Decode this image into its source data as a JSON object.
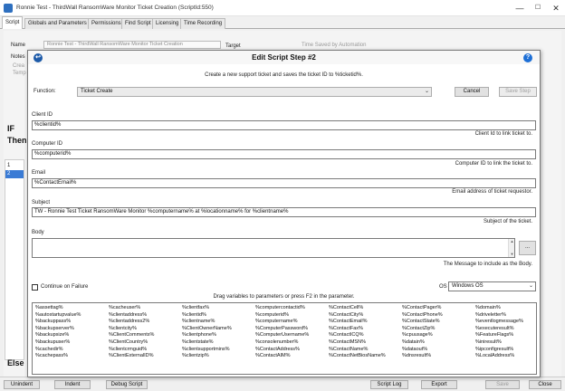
{
  "window": {
    "title": "Ronnie Test - ThirdWall RansomWare Monitor Ticket Creation   (ScriptId:550)",
    "min": "—",
    "max": "☐",
    "close": "✕"
  },
  "tabs": [
    "Script",
    "Globals and Parameters",
    "Permissions",
    "Find Script",
    "Licensing",
    "Time Recording"
  ],
  "background": {
    "name_label": "Name",
    "name_value": "Ronnie Test - ThirdWall RansomWare Monitor Ticket Creation",
    "target_label": "Target",
    "time_saved_label": "Time Saved by Automation",
    "notes_label": "Notes",
    "notes_line1": "Crea",
    "notes_line2": "Temp",
    "if_label": "IF",
    "then_label": "Then",
    "else_label": "Else",
    "rows": [
      "1",
      "2"
    ]
  },
  "bottom_buttons": [
    "Unindent",
    "Indent",
    "Debug Script",
    "Script Log",
    "Export",
    "Save",
    "Close"
  ],
  "dialog": {
    "title": "Edit Script Step #2",
    "left_icon": "↩",
    "right_icon": "?",
    "description": "Create a new support ticket and saves the ticket ID to %ticketid%.",
    "function_label": "Function:",
    "function_value": "Ticket Create",
    "cancel_label": "Cancel",
    "save_step_label": "Save Step",
    "fields": [
      {
        "label": "Client ID",
        "value": "%clientid%",
        "hint": "Client Id to link ticket to."
      },
      {
        "label": "Computer ID",
        "value": "%computerid%",
        "hint": "Computer ID to link the ticket to."
      },
      {
        "label": "Email",
        "value": "%ContactEmail%",
        "hint": "Email address of ticket requestor."
      },
      {
        "label": "Subject",
        "value": "TW - Ronnie Test Ticket RansomWare Monitor %computername% at %locationname% for %clientname%",
        "hint": "Subject of the ticket."
      }
    ],
    "body_label": "Body",
    "body_hint": "The Message to include as the Body.",
    "ellipsis_label": "...",
    "continue_label": "Continue on Failure",
    "continue_checked": false,
    "os_label": "OS",
    "os_value": "Windows OS",
    "drag_hint": "Drag variables to parameters or press F2 in the parameter.",
    "variables": [
      [
        "%assettag%",
        "%autostartupvalue%",
        "%backuppass%",
        "%backupserver%",
        "%backupsize%",
        "%backupuser%",
        "%cachedir%",
        "%cachepass%"
      ],
      [
        "%cacheuser%",
        "%clientaddress%",
        "%clientaddress2%",
        "%clientcity%",
        "%ClientComments%",
        "%ClientCountry%",
        "%clientcrmguid%",
        "%ClientExternalID%"
      ],
      [
        "%clientfax%",
        "%clientid%",
        "%clientname%",
        "%ClientOwnerName%",
        "%clientphone%",
        "%clientstate%",
        "%clientsupportmins%",
        "%clientzip%"
      ],
      [
        "%computercontactid%",
        "%computerid%",
        "%computername%",
        "%ComputerPassword%",
        "%ComputerUsername%",
        "%consolenumber%",
        "%ContactAddress%",
        "%ContactAIM%"
      ],
      [
        "%ContactCell%",
        "%ContactCity%",
        "%ContactEmail%",
        "%ContactFax%",
        "%ContactICQ%",
        "%ContactMSN%",
        "%ContactName%",
        "%ContactNetBiosName%"
      ],
      [
        "%ContactPager%",
        "%ContactPhone%",
        "%ContactState%",
        "%ContactZip%",
        "%cpuusage%",
        "%datain%",
        "%dataout%",
        "%dnsresult%"
      ],
      [
        "%domain%",
        "%driveletter%",
        "%eventlogmessage%",
        "%executeresult%",
        "%FeatureFlags%",
        "%iniresult%",
        "%ipconfigresult%",
        "%LocalAddress%"
      ]
    ]
  }
}
